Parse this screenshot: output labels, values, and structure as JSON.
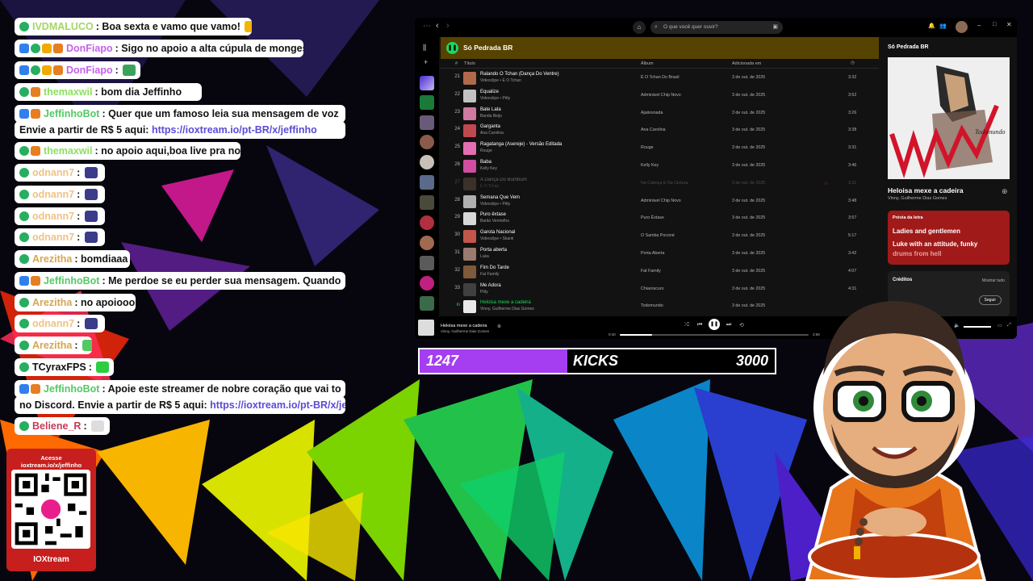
{
  "chat": [
    {
      "badges": [
        "check"
      ],
      "user": "IVDMALUCO",
      "color": "#a5d663",
      "text": ": Boa sexta e vamo que vamo! ",
      "emote": "#f4b400",
      "link": ""
    },
    {
      "badges": [
        "bot",
        "check",
        "sub",
        "gift"
      ],
      "user": "DonFiapo",
      "color": "#c561e8",
      "text": ": Sigo no apoio a alta cúpula de monges !",
      "emote": "",
      "link": ""
    },
    {
      "badges": [
        "bot",
        "check",
        "sub",
        "gift"
      ],
      "user": "DonFiapo",
      "color": "#c561e8",
      "text": ": ",
      "emote": "#3aa35b",
      "link": ""
    },
    {
      "badges": [
        "check",
        "gift"
      ],
      "user": "themaxwil",
      "color": "#8be05f",
      "text": ": bom dia Jeffinho",
      "emote": "",
      "link": ""
    },
    {
      "badges": [
        "bot",
        "gift"
      ],
      "user": "JeffinhoBot",
      "color": "#53c964",
      "text": ": Quer que um famoso leia sua mensagem de voz",
      "emote": "",
      "link": ""
    },
    {
      "badges": [],
      "user": "",
      "color": "#111",
      "text": "Envie a partir de R$ 5 aqui: ",
      "emote": "",
      "link": "https://ioxtream.io/pt-BR/x/jeffinho"
    },
    {
      "badges": [
        "check",
        "gift"
      ],
      "user": "themaxwil",
      "color": "#8be05f",
      "text": ": no apoio aqui,boa live pra nos",
      "emote": "",
      "link": ""
    },
    {
      "badges": [
        "check"
      ],
      "user": "odnann7",
      "color": "#f0c283",
      "text": ": ",
      "emote": "#3b3b8c",
      "link": ""
    },
    {
      "badges": [
        "check"
      ],
      "user": "odnann7",
      "color": "#f0c283",
      "text": ": ",
      "emote": "#3b3b8c",
      "link": ""
    },
    {
      "badges": [
        "check"
      ],
      "user": "odnann7",
      "color": "#f0c283",
      "text": ": ",
      "emote": "#3b3b8c",
      "link": ""
    },
    {
      "badges": [
        "check"
      ],
      "user": "odnann7",
      "color": "#f0c283",
      "text": ": ",
      "emote": "#3b3b8c",
      "link": ""
    },
    {
      "badges": [
        "check"
      ],
      "user": "Arezitha",
      "color": "#d6a64f",
      "text": ": bomdiaaa",
      "emote": "",
      "link": ""
    },
    {
      "badges": [
        "bot",
        "gift"
      ],
      "user": "JeffinhoBot",
      "color": "#53c964",
      "text": ": Me perdoe se eu perder sua mensagem. Quando",
      "emote": "",
      "link": ""
    },
    {
      "badges": [
        "check"
      ],
      "user": "Arezitha",
      "color": "#d6a64f",
      "text": ": no apoiooo",
      "emote": "",
      "link": ""
    },
    {
      "badges": [
        "check"
      ],
      "user": "odnann7",
      "color": "#f0c283",
      "text": ": ",
      "emote": "#3b3b8c",
      "link": ""
    },
    {
      "badges": [
        "check"
      ],
      "user": "Arezitha",
      "color": "#d6a64f",
      "text": ": ",
      "emote": "#53c964",
      "link": ""
    },
    {
      "badges": [
        "check"
      ],
      "user": "TCyraxFPS",
      "color": "#111",
      "text": ": ",
      "emote": "#2ecc40",
      "link": ""
    },
    {
      "badges": [
        "bot",
        "gift"
      ],
      "user": "JeffinhoBot",
      "color": "#53c964",
      "text": ": Apoie este streamer de nobre coração que vai to",
      "emote": "",
      "link": ""
    },
    {
      "badges": [],
      "user": "",
      "color": "#111",
      "text": "no Discord. Envie a partir de R$ 5 aqui: ",
      "emote": "",
      "link": "https://ioxtream.io/pt-BR/x/jeffin"
    },
    {
      "badges": [
        "check"
      ],
      "user": "Beliene_R",
      "color": "#c43b5a",
      "text": ": ",
      "emote": "#dddddd",
      "link": ""
    }
  ],
  "qr": {
    "line1": "Acesse",
    "line2": "ioxtream.io/x/jeffinho",
    "brand": "IOXtream"
  },
  "spotify": {
    "search_placeholder": "O que você quer ouvir?",
    "playlist_title": "Só Pedrada BR",
    "columns": {
      "num": "#",
      "title": "Título",
      "album": "Álbum",
      "added": "Adicionada em"
    },
    "rows": [
      {
        "num": "21",
        "title": "Ralando O Tchan (Dança Do Ventre)",
        "artist": "Videoclipe • É O Tchan",
        "album": "É O Tchan Do Brasil",
        "date": "3 de out. de 2025",
        "dur": "3:32",
        "art": "#b06a4a",
        "state": ""
      },
      {
        "num": "22",
        "title": "Equalize",
        "artist": "Videoclipe • Pitty",
        "album": "Admirável Chip Novo",
        "date": "3 de out. de 2025",
        "dur": "3:52",
        "art": "#c2c2c2",
        "state": ""
      },
      {
        "num": "23",
        "title": "Bate Lata",
        "artist": "Banda Beijo",
        "album": "Ajaiiosnada",
        "date": "3 de out. de 2025",
        "dur": "3:26",
        "art": "#d07aa0",
        "state": ""
      },
      {
        "num": "24",
        "title": "Garganta",
        "artist": "Ana Carolina",
        "album": "Ana Carolina",
        "date": "3 de out. de 2025",
        "dur": "3:38",
        "art": "#c0484f",
        "state": ""
      },
      {
        "num": "25",
        "title": "Ragatanga (Asereje) - Versão Editada",
        "artist": "Rouge",
        "album": "Rouge",
        "date": "3 de out. de 2025",
        "dur": "3:31",
        "art": "#e36eb1",
        "state": ""
      },
      {
        "num": "26",
        "title": "Baba",
        "artist": "Kelly Key",
        "album": "Kelly Key",
        "date": "3 de out. de 2025",
        "dur": "3:46",
        "art": "#d04da0",
        "state": ""
      },
      {
        "num": "27",
        "title": "A Dança Do Bumbum",
        "artist": "É O Tchan",
        "album": "Na Cabeça E Na Cintura",
        "date": "3 de out. de 2025",
        "dur": "3:11",
        "art": "#8a6a5a",
        "state": "dim"
      },
      {
        "num": "28",
        "title": "Semana Que Vem",
        "artist": "Videoclipe • Pitty",
        "album": "Admirável Chip Novo",
        "date": "3 de out. de 2025",
        "dur": "3:48",
        "art": "#b0b0b0",
        "state": ""
      },
      {
        "num": "29",
        "title": "Puro êxtase",
        "artist": "Barão Vermelho",
        "album": "Puro Êxtase",
        "date": "3 de out. de 2025",
        "dur": "3:57",
        "art": "#d8d8d8",
        "state": ""
      },
      {
        "num": "30",
        "title": "Garota Nacional",
        "artist": "Videoclipe • Skank",
        "album": "O Samba Poconé",
        "date": "3 de out. de 2025",
        "dur": "5:17",
        "art": "#c2564b",
        "state": ""
      },
      {
        "num": "31",
        "title": "Porta aberta",
        "artist": "Luka",
        "album": "Porta Aberta",
        "date": "3 de out. de 2025",
        "dur": "3:42",
        "art": "#9a7b6e",
        "state": ""
      },
      {
        "num": "32",
        "title": "Fim Do Tarde",
        "artist": "Fat Family",
        "album": "Fat Family",
        "date": "3 de out. de 2025",
        "dur": "4:07",
        "art": "#7f5a3a",
        "state": ""
      },
      {
        "num": "33",
        "title": "Me Adora",
        "artist": "Pitty",
        "album": "Chiaroscuro",
        "date": "3 de out. de 2025",
        "dur": "4:31",
        "art": "#404040",
        "state": ""
      },
      {
        "num": "ılı",
        "title": "Heloisa mexe a cadeira",
        "artist": "Vinny, Guilherme Dias Gomes",
        "album": "Todomundo",
        "date": "3 de out. de 2025",
        "dur": "",
        "art": "#e8e8e8",
        "state": "active"
      }
    ],
    "right_title": "Só Pedrada BR",
    "cover_text": "Todomundo",
    "song_title": "Heloisa mexe a cadeira",
    "song_artist": "Vinny, Guilherme Dias Gomes",
    "lyrics_label": "Prévia da letra",
    "lyrics_line1": "Ladies and gentlemen",
    "lyrics_line2": "Luke with an attitude, funky",
    "lyrics_line3": "drums from hell",
    "credits": "Créditos",
    "show_all": "Mostrar tudo",
    "follow": "Seguir",
    "player_title": "Heloisa mexe a cadeira",
    "player_artist": "Vinny, Guilherme Dias Gomes",
    "elapsed": "0:40",
    "total": "3:58",
    "progress": 0.17
  },
  "kicks": {
    "current": "1247",
    "label": "KICKS",
    "goal": "3000",
    "current_value": 1247,
    "goal_value": 3000
  },
  "colors": {
    "spotify_green": "#1ed760",
    "kick_purple": "#a43ef0",
    "lyrics_red": "#a01a1a"
  }
}
